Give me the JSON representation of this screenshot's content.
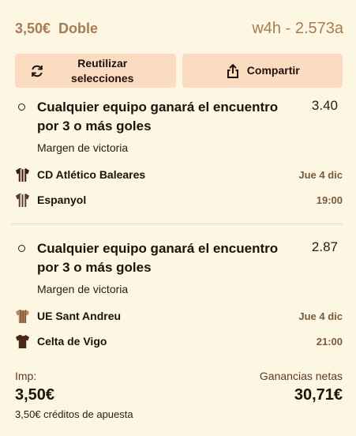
{
  "header": {
    "stake": "3,50€",
    "bet_type": "Doble",
    "bet_code": "w4h - 2.573a"
  },
  "actions": {
    "reuse_label": "Reutilizar\nselecciones",
    "share_label": "Compartir"
  },
  "legs": [
    {
      "selection": "Cualquier equipo ganará el encuentro por 3 o más goles",
      "odds": "3.40",
      "market": "Margen de victoria",
      "home": {
        "name": "CD Atlético Baleares",
        "shirt": "striped-red-black-shirt-icon",
        "date": "Jue 4 dic"
      },
      "away": {
        "name": "Espanyol",
        "shirt": "striped-blue-white-shirt-icon",
        "time": "19:00"
      }
    },
    {
      "selection": "Cualquier equipo ganará el encuentro por 3 o más goles",
      "odds": "2.87",
      "market": "Margen de victoria",
      "home": {
        "name": "UE Sant Andreu",
        "shirt": "striped-yellow-red-shirt-icon",
        "date": "Jue 4 dic"
      },
      "away": {
        "name": "Celta de Vigo",
        "shirt": "plain-blue-shirt-icon",
        "time": "21:00"
      }
    }
  ],
  "footer": {
    "imp_label": "Imp:",
    "imp_value": "3,50€",
    "net_label": "Ganancias netas",
    "net_value": "30,71€",
    "credits": "3,50€ créditos de apuesta"
  },
  "colors": {
    "background": "#fdf6e3",
    "button": "#fbdcc0",
    "muted": "#a67c52"
  }
}
